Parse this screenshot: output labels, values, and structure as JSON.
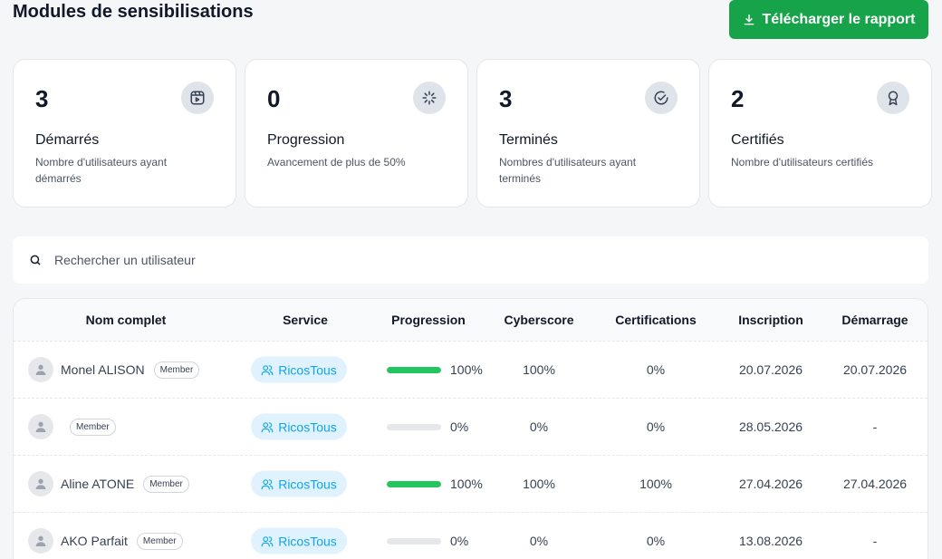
{
  "page_title": "Modules de sensibilisations",
  "download_button": "Télécharger le rapport",
  "cards": [
    {
      "value": "3",
      "title": "Démarrés",
      "desc": "Nombre d'utilisateurs ayant démarrés",
      "icon": "video-icon"
    },
    {
      "value": "0",
      "title": "Progression",
      "desc": "Avancement de plus de 50%",
      "icon": "loader-icon"
    },
    {
      "value": "3",
      "title": "Terminés",
      "desc": "Nombres d'utilisateurs ayant terminés",
      "icon": "check-circle-icon"
    },
    {
      "value": "2",
      "title": "Certifiés",
      "desc": "Nombre d'utilisateurs certifiés",
      "icon": "award-icon"
    }
  ],
  "search": {
    "placeholder": "Rechercher un utilisateur"
  },
  "table": {
    "headers": [
      "Nom complet",
      "Service",
      "Progression",
      "Cyberscore",
      "Certifications",
      "Inscription",
      "Démarrage"
    ],
    "rows": [
      {
        "name": "Monel ALISON",
        "badge": "Member",
        "service": "RicosTous",
        "progress": 1.0,
        "progress_label": "100%",
        "cyberscore": "100%",
        "certifications": "0%",
        "inscription": "20.07.2026",
        "demarrage": "20.07.2026"
      },
      {
        "name": "",
        "badge": "Member",
        "service": "RicosTous",
        "progress": 0.0,
        "progress_label": "0%",
        "cyberscore": "0%",
        "certifications": "0%",
        "inscription": "28.05.2026",
        "demarrage": "-"
      },
      {
        "name": "Aline ATONE",
        "badge": "Member",
        "service": "RicosTous",
        "progress": 1.0,
        "progress_label": "100%",
        "cyberscore": "100%",
        "certifications": "100%",
        "inscription": "27.04.2026",
        "demarrage": "27.04.2026"
      },
      {
        "name": "AKO Parfait",
        "badge": "Member",
        "service": "RicosTous",
        "progress": 0.0,
        "progress_label": "0%",
        "cyberscore": "0%",
        "certifications": "0%",
        "inscription": "13.08.2026",
        "demarrage": "-"
      }
    ]
  },
  "colors": {
    "accent": "#16a34a",
    "service_bg": "#e0f2fe",
    "service_text": "#0ea5e9",
    "progress": "#22c55e"
  }
}
